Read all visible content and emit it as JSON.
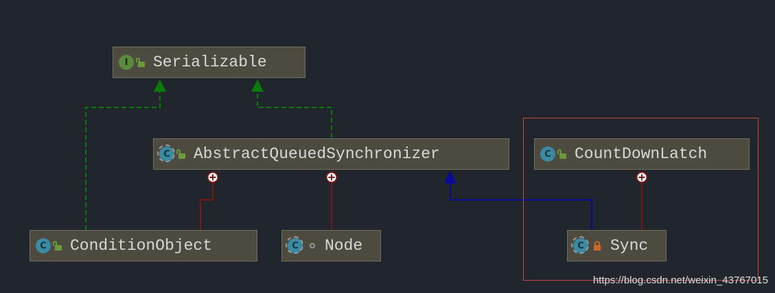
{
  "nodes": {
    "serializable": {
      "label": "Serializable",
      "kind": "interface",
      "badge": "I",
      "visibility": "public"
    },
    "aqs": {
      "label": "AbstractQueuedSynchronizer",
      "kind": "abstract-class",
      "badge": "C",
      "visibility": "public"
    },
    "count_down_latch": {
      "label": "CountDownLatch",
      "kind": "class",
      "badge": "C",
      "visibility": "public"
    },
    "condition_object": {
      "label": "ConditionObject",
      "kind": "class",
      "badge": "C",
      "visibility": "public"
    },
    "node": {
      "label": "Node",
      "kind": "static-final-class",
      "badge": "C",
      "visibility": "package-private"
    },
    "sync": {
      "label": "Sync",
      "kind": "static-abstract-class",
      "badge": "C",
      "visibility": "private"
    }
  },
  "edges": [
    {
      "from": "condition_object",
      "to": "serializable",
      "type": "implements"
    },
    {
      "from": "aqs",
      "to": "serializable",
      "type": "implements"
    },
    {
      "from": "sync",
      "to": "aqs",
      "type": "extends"
    },
    {
      "from": "aqs",
      "to": "condition_object",
      "type": "inner-class"
    },
    {
      "from": "aqs",
      "to": "node",
      "type": "inner-class"
    },
    {
      "from": "count_down_latch",
      "to": "sync",
      "type": "inner-class"
    }
  ],
  "colors": {
    "background": "#21262c",
    "node_fill": "#4d4b40",
    "implements_edge": "#0a7a0a",
    "extends_edge": "#0a0a9a",
    "inner_class_edge": "#7a1616",
    "highlight_border": "#c9464a"
  },
  "watermark": "https://blog.csdn.net/weixin_43767015"
}
